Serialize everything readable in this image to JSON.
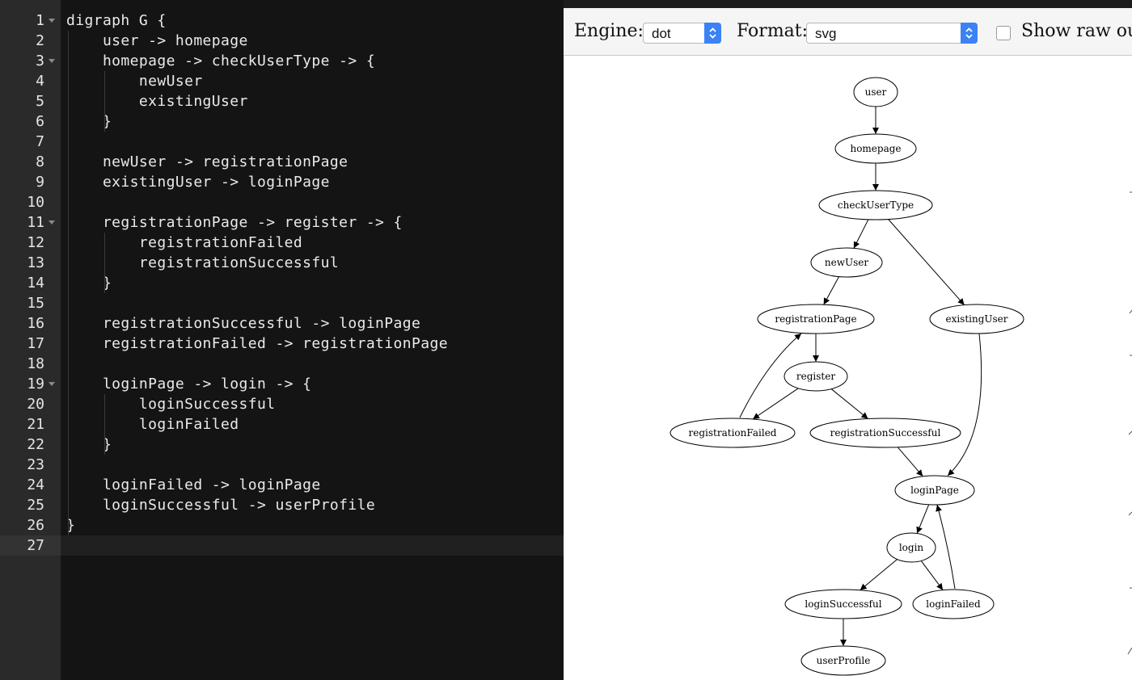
{
  "editor": {
    "lines": [
      {
        "n": "1",
        "text": "digraph G {",
        "fold": true
      },
      {
        "n": "2",
        "text": "    user -> homepage",
        "fold": false
      },
      {
        "n": "3",
        "text": "    homepage -> checkUserType -> {",
        "fold": true
      },
      {
        "n": "4",
        "text": "        newUser",
        "fold": false
      },
      {
        "n": "5",
        "text": "        existingUser",
        "fold": false
      },
      {
        "n": "6",
        "text": "    }",
        "fold": false
      },
      {
        "n": "7",
        "text": "",
        "fold": false
      },
      {
        "n": "8",
        "text": "    newUser -> registrationPage",
        "fold": false
      },
      {
        "n": "9",
        "text": "    existingUser -> loginPage",
        "fold": false
      },
      {
        "n": "10",
        "text": "",
        "fold": false
      },
      {
        "n": "11",
        "text": "    registrationPage -> register -> {",
        "fold": true
      },
      {
        "n": "12",
        "text": "        registrationFailed",
        "fold": false
      },
      {
        "n": "13",
        "text": "        registrationSuccessful",
        "fold": false
      },
      {
        "n": "14",
        "text": "    }",
        "fold": false
      },
      {
        "n": "15",
        "text": "",
        "fold": false
      },
      {
        "n": "16",
        "text": "    registrationSuccessful -> loginPage",
        "fold": false
      },
      {
        "n": "17",
        "text": "    registrationFailed -> registrationPage",
        "fold": false
      },
      {
        "n": "18",
        "text": "",
        "fold": false
      },
      {
        "n": "19",
        "text": "    loginPage -> login -> {",
        "fold": true
      },
      {
        "n": "20",
        "text": "        loginSuccessful",
        "fold": false
      },
      {
        "n": "21",
        "text": "        loginFailed",
        "fold": false
      },
      {
        "n": "22",
        "text": "    }",
        "fold": false
      },
      {
        "n": "23",
        "text": "",
        "fold": false
      },
      {
        "n": "24",
        "text": "    loginFailed -> loginPage",
        "fold": false
      },
      {
        "n": "25",
        "text": "    loginSuccessful -> userProfile",
        "fold": false
      },
      {
        "n": "26",
        "text": "}",
        "fold": false
      },
      {
        "n": "27",
        "text": "",
        "fold": false
      }
    ],
    "active_line": "27"
  },
  "toolbar": {
    "engine_label": "Engine:",
    "engine_value": "dot",
    "format_label": "Format:",
    "format_value": "svg",
    "show_raw_label": "Show raw ou",
    "show_raw_checked": false,
    "select_accent": "#3b82f6"
  },
  "graph": {
    "nodes": [
      {
        "id": "user",
        "label": "user"
      },
      {
        "id": "homepage",
        "label": "homepage"
      },
      {
        "id": "checkUserType",
        "label": "checkUserType"
      },
      {
        "id": "newUser",
        "label": "newUser"
      },
      {
        "id": "existingUser",
        "label": "existingUser"
      },
      {
        "id": "registrationPage",
        "label": "registrationPage"
      },
      {
        "id": "register",
        "label": "register"
      },
      {
        "id": "registrationFailed",
        "label": "registrationFailed"
      },
      {
        "id": "registrationSuccessful",
        "label": "registrationSuccessful"
      },
      {
        "id": "loginPage",
        "label": "loginPage"
      },
      {
        "id": "login",
        "label": "login"
      },
      {
        "id": "loginSuccessful",
        "label": "loginSuccessful"
      },
      {
        "id": "loginFailed",
        "label": "loginFailed"
      },
      {
        "id": "userProfile",
        "label": "userProfile"
      }
    ],
    "edges": [
      {
        "from": "user",
        "to": "homepage"
      },
      {
        "from": "homepage",
        "to": "checkUserType"
      },
      {
        "from": "checkUserType",
        "to": "newUser"
      },
      {
        "from": "checkUserType",
        "to": "existingUser"
      },
      {
        "from": "newUser",
        "to": "registrationPage"
      },
      {
        "from": "existingUser",
        "to": "loginPage"
      },
      {
        "from": "registrationPage",
        "to": "register"
      },
      {
        "from": "register",
        "to": "registrationFailed"
      },
      {
        "from": "register",
        "to": "registrationSuccessful"
      },
      {
        "from": "registrationSuccessful",
        "to": "loginPage"
      },
      {
        "from": "registrationFailed",
        "to": "registrationPage"
      },
      {
        "from": "loginPage",
        "to": "login"
      },
      {
        "from": "login",
        "to": "loginSuccessful"
      },
      {
        "from": "login",
        "to": "loginFailed"
      },
      {
        "from": "loginFailed",
        "to": "loginPage"
      },
      {
        "from": "loginSuccessful",
        "to": "userProfile"
      }
    ]
  }
}
